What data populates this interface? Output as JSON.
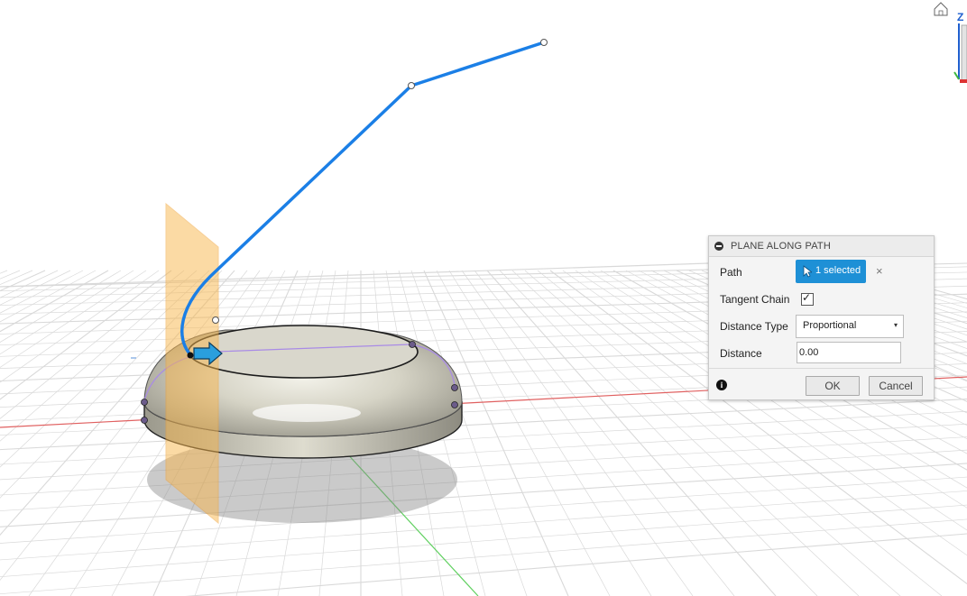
{
  "viewcube": {
    "axis_label": "Z"
  },
  "dialog": {
    "title": "PLANE ALONG PATH",
    "path": {
      "label": "Path",
      "selection": "1 selected",
      "clear_symbol": "×"
    },
    "tangent_chain": {
      "label": "Tangent Chain",
      "checked": true,
      "check_symbol": "✓"
    },
    "distance_type": {
      "label": "Distance Type",
      "value": "Proportional",
      "caret": "▾"
    },
    "distance": {
      "label": "Distance",
      "value": "0.00"
    },
    "info_symbol": "i",
    "ok_label": "OK",
    "cancel_label": "Cancel"
  },
  "colors": {
    "path_curve": "#1b7fe6",
    "plane": "#f8b64c",
    "selection_button": "#1e90d6",
    "grid": "#d4d4d4",
    "x_axis": "#e05050",
    "y_axis": "#4fcf4f"
  }
}
